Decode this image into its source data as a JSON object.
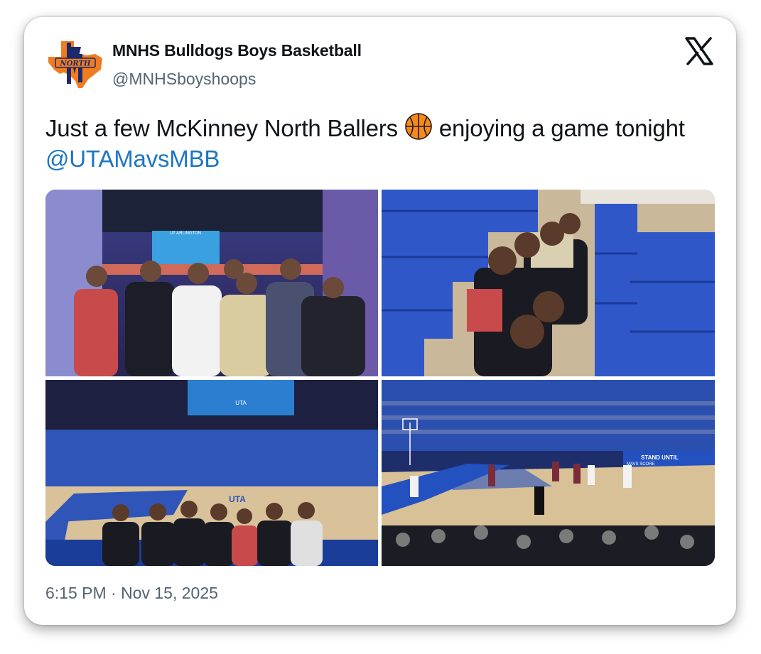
{
  "tweet": {
    "display_name": "MNHS Bulldogs Boys Basketball",
    "handle": "@MNHSboyshoops",
    "text_part1": "Just a few McKinney North Ballers ",
    "text_part2": " enjoying a game tonight ",
    "mention": "@UTAMavsMBB",
    "timestamp": "6:15 PM · Nov 15, 2025"
  },
  "avatar": {
    "logo_text": "NORTH",
    "icon": "texas-north-logo"
  },
  "icons": {
    "close": "x-logo-icon",
    "emoji": "basketball-emoji"
  },
  "photos": {
    "p1": {
      "scoreboard_text": "UT ARLINGTON"
    },
    "p3": {
      "scoreboard_text": "UTA",
      "floor_text": "UTA"
    },
    "p4": {
      "banner_text": "STAND UNTIL",
      "banner_sub": "MAVS SCORE"
    }
  },
  "colors": {
    "accent": "#1d76c2",
    "text": "#0f1419",
    "muted": "#536471",
    "logo_orange": "#f07c22",
    "logo_navy": "#1b2a6b"
  }
}
